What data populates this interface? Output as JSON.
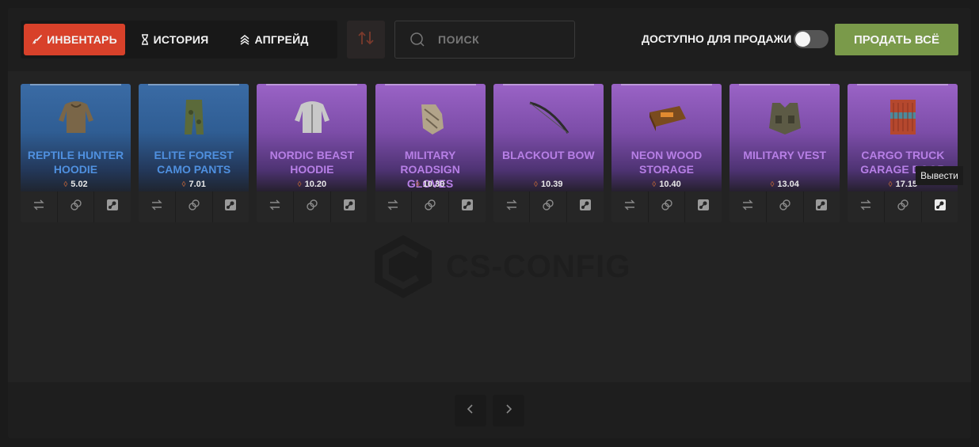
{
  "tabs": [
    {
      "label": "ИНВЕНТАРЬ",
      "icon": "rifle-icon",
      "active": true
    },
    {
      "label": "ИСТОРИЯ",
      "icon": "hourglass-icon",
      "active": false
    },
    {
      "label": "АПГРЕЙД",
      "icon": "chevrons-up-icon",
      "active": false
    }
  ],
  "sort_icon": "sort-arrows-icon",
  "search": {
    "placeholder": "ПОИСК",
    "value": ""
  },
  "available_for_sale": {
    "label": "ДОСТУПНО ДЛЯ ПРОДАЖИ",
    "enabled": false
  },
  "sell_all_label": "ПРОДАТЬ ВСЁ",
  "accent_colors": {
    "active_tab": "#d8412a",
    "sell_button": "#7a9a4a",
    "blue_item": "#4f90df",
    "purple_item": "#b77fe6"
  },
  "items": [
    {
      "name": "REPTILE HUNTER HOODIE",
      "price": "5.02",
      "rarity": "blue"
    },
    {
      "name": "ELITE FOREST CAMO PANTS",
      "price": "7.01",
      "rarity": "blue"
    },
    {
      "name": "NORDIC BEAST HOODIE",
      "price": "10.20",
      "rarity": "purple"
    },
    {
      "name": "MILITARY ROADSIGN GLOVES",
      "price": "10.30",
      "rarity": "purple"
    },
    {
      "name": "BLACKOUT BOW",
      "price": "10.39",
      "rarity": "purple"
    },
    {
      "name": "NEON WOOD STORAGE",
      "price": "10.40",
      "rarity": "purple"
    },
    {
      "name": "MILITARY VEST",
      "price": "13.04",
      "rarity": "purple"
    },
    {
      "name": "CARGO TRUCK GARAGE DOOR",
      "price": "17.15",
      "rarity": "purple"
    }
  ],
  "item_actions": [
    "exchange-icon",
    "upgrade-link-icon",
    "steam-withdraw-icon"
  ],
  "tooltip": "Вывести",
  "watermark": "CS-CONFIG",
  "pagination": {
    "prev_icon": "chevron-left-icon",
    "next_icon": "chevron-right-icon"
  }
}
